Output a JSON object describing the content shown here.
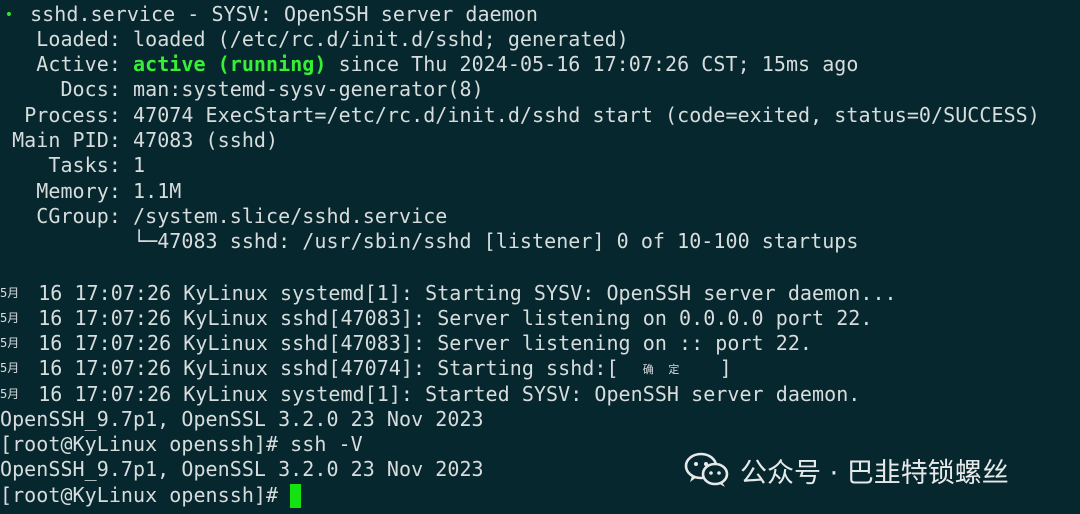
{
  "terminal": {
    "status_block": {
      "bullet": "•",
      "title": "sshd.service - SYSV: OpenSSH server daemon",
      "loaded": {
        "label": "Loaded:",
        "value": "loaded (/etc/rc.d/init.d/sshd; generated)"
      },
      "active": {
        "label": "Active:",
        "state": "active (running)",
        "rest": "since Thu 2024-05-16 17:07:26 CST; 15ms ago"
      },
      "docs": {
        "label": "Docs:",
        "value": "man:systemd-sysv-generator(8)"
      },
      "process": {
        "label": "Process:",
        "value": "47074 ExecStart=/etc/rc.d/init.d/sshd start (code=exited, status=0/SUCCESS)"
      },
      "main_pid": {
        "label": "Main PID:",
        "value": "47083 (sshd)"
      },
      "tasks": {
        "label": "Tasks:",
        "value": "1"
      },
      "memory": {
        "label": "Memory:",
        "value": "1.1M"
      },
      "cgroup": {
        "label": "CGroup:",
        "value": "/system.slice/sshd.service"
      },
      "cgroup_child": "└─47083 sshd: /usr/sbin/sshd [listener] 0 of 10-100 startups"
    },
    "log_lines": [
      {
        "month": "5月",
        "text": "16 17:07:26 KyLinux systemd[1]: Starting SYSV: OpenSSH server daemon..."
      },
      {
        "month": "5月",
        "text": "16 17:07:26 KyLinux sshd[47083]: Server listening on 0.0.0.0 port 22."
      },
      {
        "month": "5月",
        "text": "16 17:07:26 KyLinux sshd[47083]: Server listening on :: port 22."
      },
      {
        "month": "5月",
        "text": "16 17:07:26 KyLinux sshd[47074]: Starting sshd:[",
        "ok": "确 定",
        "close": "]"
      },
      {
        "month": "5月",
        "text": "16 17:07:26 KyLinux systemd[1]: Started SYSV: OpenSSH server daemon."
      }
    ],
    "output": [
      "OpenSSH_9.7p1, OpenSSL 3.2.0 23 Nov 2023",
      "[root@KyLinux openssh]# ssh -V",
      "OpenSSH_9.7p1, OpenSSL 3.2.0 23 Nov 2023"
    ],
    "prompt": "[root@KyLinux openssh]# "
  },
  "watermark": {
    "icon": "wechat-icon",
    "text": "公众号 · 巴韭特锁螺丝"
  },
  "colors": {
    "background": "#07272e",
    "text": "#d7dcdc",
    "active_green": "#35f035",
    "cursor_green": "#13e313"
  }
}
